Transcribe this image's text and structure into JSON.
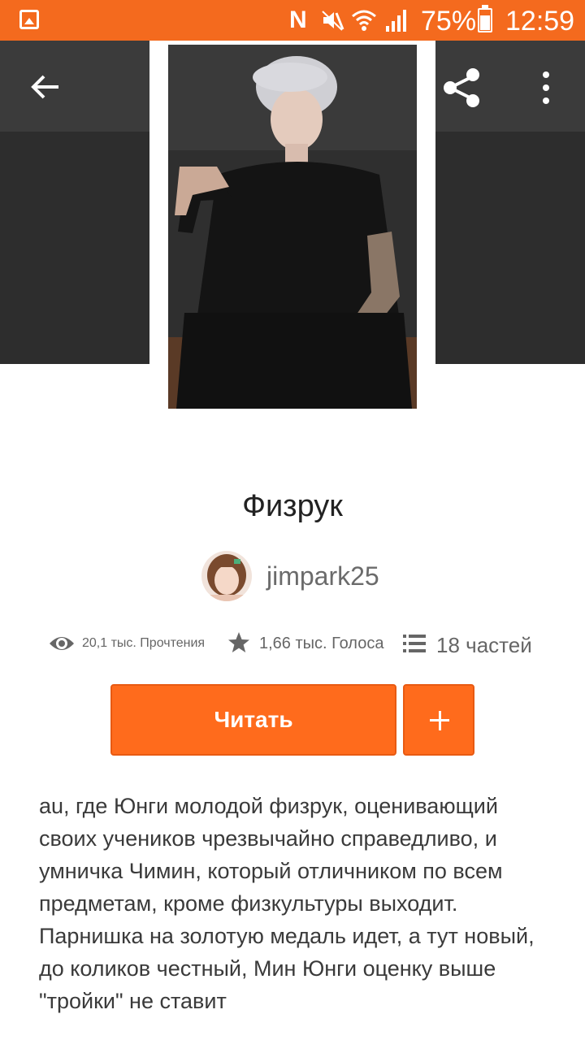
{
  "status_bar": {
    "n_label": "N",
    "battery_percent": "75%",
    "battery_level": 0.75,
    "time": "12:59"
  },
  "toolbar": {
    "back_icon": "arrow-back-icon",
    "share_icon": "share-icon",
    "more_icon": "more-vert-icon"
  },
  "story": {
    "title": "Физрук",
    "author": "jimpark25",
    "stats": {
      "reads": "20,1 тыс. Прочтения",
      "votes": "1,66 тыс. Голоса",
      "parts": "18 частей"
    },
    "read_label": "Читать",
    "add_label": "+",
    "description": "au, где Юнги молодой физрук, оценивающий своих учеников чрезвычайно справедливо, и умничка Чимин, который отличником по всем предметам, кроме физкультуры выходит. Парнишка на золотую медаль идет, а тут новый, до коликов честный, Мин Юнги оценку выше \"тройки\" не ставит"
  },
  "colors": {
    "accent": "#ff6b1c",
    "status_bar": "#f46a1e",
    "header_dark": "#2d2d2d"
  }
}
